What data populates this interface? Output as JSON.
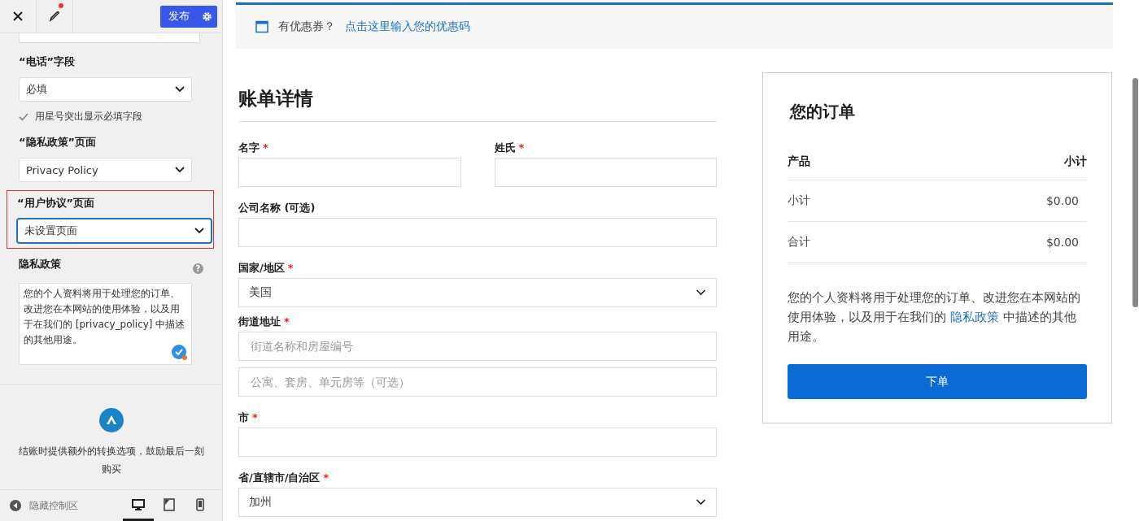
{
  "sidebar": {
    "header": {
      "publish": "发布",
      "edited": true
    },
    "controls": [
      {
        "kind": "select",
        "label": "“电话”字段",
        "value": "必填",
        "highlighted": false
      },
      {
        "kind": "checkbox",
        "label": "用星号突出显示必填字段",
        "checked": true
      },
      {
        "kind": "select",
        "label": "“隐私政策”页面",
        "value": "Privacy Policy",
        "highlighted": false
      },
      {
        "kind": "select",
        "label": "“用户协议”页面",
        "value": "未设置页面",
        "highlighted": true
      },
      {
        "kind": "textarea",
        "label": "隐私政策",
        "help": "?",
        "value": "您的个人资料将用于处理您的订单、改进您在本网站的使用体验，以及用于在我们的 [privacy_policy] 中描述的其他用途。"
      }
    ],
    "promo": "结账时提供额外的转换选项，鼓励最后一刻购买",
    "footer": {
      "hide": "隐藏控制区",
      "devices": [
        {
          "kind": "desktop",
          "selected": true
        },
        {
          "kind": "tablet",
          "selected": false
        },
        {
          "kind": "mobile",
          "selected": false
        }
      ]
    }
  },
  "coupon": {
    "text": "有优惠券？",
    "link": "点击这里输入您的优惠码"
  },
  "billing": {
    "title": "账单详情",
    "rows": [
      [
        {
          "label": "名字",
          "required_mark": "*",
          "kind": "input"
        },
        {
          "label": "姓氏",
          "required_mark": "*",
          "kind": "input"
        }
      ],
      [
        {
          "label": "公司名称 (可选)",
          "kind": "input"
        }
      ],
      [
        {
          "label": "国家/地区",
          "required_mark": "*",
          "kind": "select",
          "value": "美国"
        }
      ],
      [
        {
          "label": "街道地址",
          "required_mark": "*",
          "kind": "input",
          "placeholder": "街道名称和房屋编号"
        }
      ],
      [
        {
          "kind": "input",
          "placeholder": "公寓、套房、单元房等（可选）"
        }
      ],
      [
        {
          "label": "市",
          "required_mark": "*",
          "kind": "input"
        }
      ],
      [
        {
          "label": "省/直辖市/自治区",
          "required_mark": "*",
          "kind": "select",
          "value": "加州"
        }
      ]
    ]
  },
  "order": {
    "title": "您的订单",
    "columns": [
      "产品",
      "小计"
    ],
    "rows": [
      {
        "label": "小计",
        "value": "$0.00"
      },
      {
        "label": "合计",
        "value": "$0.00"
      }
    ],
    "notice": {
      "before": "您的个人资料将用于处理您的订单、改进您在本网站的使用体验，以及用于在我们的 ",
      "link": "隐私政策",
      "after": " 中描述的其他用途。"
    },
    "button": "下单"
  }
}
